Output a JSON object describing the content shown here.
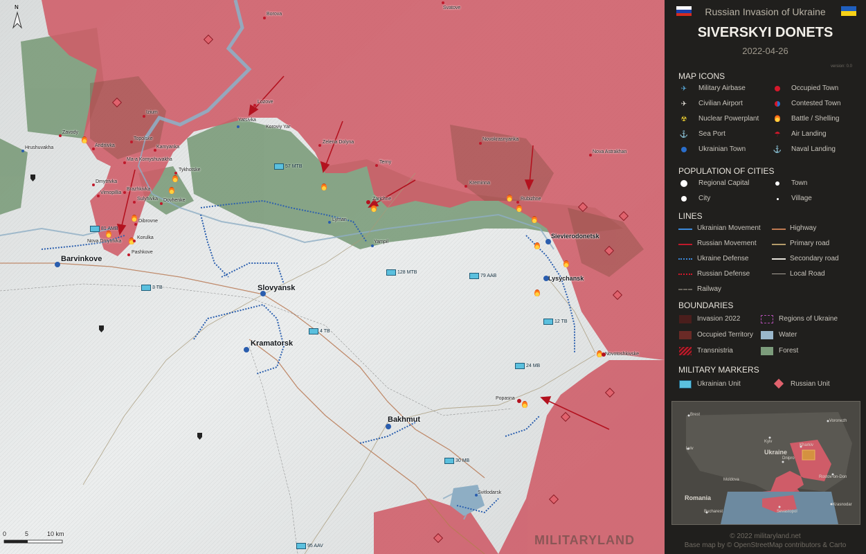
{
  "header": {
    "subtitle": "Russian Invasion of Ukraine",
    "title": "SIVERSKYI DONETS",
    "date": "2022-04-26",
    "version": "version: 0.0"
  },
  "colors": {
    "occupied": "#cf5c68",
    "ukraine_land": "#e4e6e6",
    "forest": "#7c9c7b",
    "water": "#9ab7cb",
    "ukrainian_blue": "#2b6fbf",
    "russian_red": "#c0192b",
    "panel_bg": "#201f1d"
  },
  "legend": {
    "map_icons_title": "MAP ICONS",
    "map_icons": [
      {
        "icon": "airbase-icon",
        "label": "Military Airbase"
      },
      {
        "icon": "occupied-town-icon",
        "label": "Occupied Town"
      },
      {
        "icon": "civilian-airport-icon",
        "label": "Civilian Airport"
      },
      {
        "icon": "contested-town-icon",
        "label": "Contested Town"
      },
      {
        "icon": "nuclear-icon",
        "label": "Nuclear Powerplant"
      },
      {
        "icon": "battle-icon",
        "label": "Battle / Shelling"
      },
      {
        "icon": "anchor-icon",
        "label": "Sea Port"
      },
      {
        "icon": "parachute-icon",
        "label": "Air Landing"
      },
      {
        "icon": "ukrainian-town-icon",
        "label": "Ukrainian Town"
      },
      {
        "icon": "naval-landing-icon",
        "label": "Naval Landing"
      }
    ],
    "population_title": "POPULATION OF CITIES",
    "population": [
      "Regional Capital",
      "Town",
      "City",
      "Village"
    ],
    "lines_title": "LINES",
    "lines": [
      "Ukrainian Movement",
      "Highway",
      "Russian Movement",
      "Primary road",
      "Ukraine Defense",
      "Secondary road",
      "Russian Defense",
      "Local Road",
      "Railway"
    ],
    "boundaries_title": "BOUNDARIES",
    "boundaries": [
      "Invasion 2022",
      "Regions of Ukraine",
      "Occupied Territory",
      "Water",
      "Transnistria",
      "Forest"
    ],
    "markers_title": "MILITARY MARKERS",
    "markers": [
      "Ukrainian Unit",
      "Russian Unit"
    ]
  },
  "inset": {
    "labels": [
      "Brest",
      "Voronezh",
      "Kyiv",
      "Kharkiv",
      "Lviv",
      "Ukraine",
      "Dnipro",
      "Moldova",
      "Rostov-on-Don",
      "Romania",
      "Sevastopol",
      "Krasnodar",
      "Bucharest"
    ]
  },
  "footer": {
    "copyright": "© 2022 militaryland.net",
    "basemap": "Base map by © OpenStreetMap contributors & Carto"
  },
  "map": {
    "compass": "N",
    "scale": [
      "0",
      "5",
      "10 km"
    ],
    "watermark": "MILITARYLAND",
    "major_towns": [
      "Slovyansk",
      "Kramatorsk",
      "Bakhmut",
      "Lysychansk",
      "Sievierodonetsk",
      "Barvinkove"
    ],
    "minor_towns": [
      "Lyman",
      "Popasna",
      "Svitlodarsk",
      "Novotoshkivske",
      "Kreminna",
      "Rubizhne",
      "Izium",
      "Borova",
      "Svatove",
      "Novokrasnyanka",
      "Nova Astrakhan",
      "Zelena Dolyna",
      "Terny",
      "Zarichne",
      "Yampil",
      "Lozove",
      "Yatsivka",
      "Koroviy Yar",
      "Tykhotske",
      "Dovhenke",
      "Dibrovne",
      "Korulka",
      "Pashkove",
      "Nova Dmytrivka",
      "Brazhkivka",
      "Sulyhivka",
      "Dmytrivka",
      "Virnopillia",
      "Ma-a Komyshuvakha",
      "Kamyanka",
      "Topolske",
      "Andriivka",
      "Zavody",
      "Hrushuvakha"
    ],
    "units": [
      {
        "label": "57 MTB"
      },
      {
        "label": "81 AMB"
      },
      {
        "label": "3 TB"
      },
      {
        "label": "128 MTB"
      },
      {
        "label": "79 AAB"
      },
      {
        "label": "4 TB"
      },
      {
        "label": "12 TB"
      },
      {
        "label": "24 MB"
      },
      {
        "label": "30 MB"
      },
      {
        "label": "95 AAV"
      }
    ]
  }
}
